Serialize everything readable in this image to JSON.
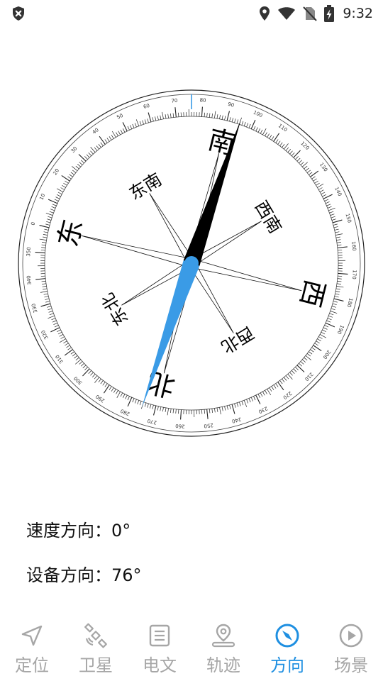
{
  "status_bar": {
    "time": "9:32",
    "left_icons": [
      "shield-x-icon"
    ],
    "right_icons": [
      "location-icon",
      "wifi-icon",
      "no-sim-icon",
      "battery-charging-icon"
    ]
  },
  "compass": {
    "cardinals": {
      "east": "东",
      "south": "南",
      "west": "西",
      "north": "北"
    },
    "intercardinals": {
      "northeast": "东北",
      "southeast": "东南",
      "southwest": "西南",
      "northwest": "西北"
    },
    "heading_degrees": 76,
    "needle_colors": {
      "north": "#3a9be6",
      "south": "#000000",
      "hub": "#3a9be6"
    }
  },
  "info": {
    "speed_direction": "速度方向：0°",
    "device_direction": "设备方向：76°"
  },
  "bottom_nav": {
    "active_color": "#1e8fe1",
    "inactive_color": "#a6a6a6",
    "items": [
      {
        "label": "定位",
        "icon": "navigation-arrow-icon",
        "active": false
      },
      {
        "label": "卫星",
        "icon": "satellite-icon",
        "active": false
      },
      {
        "label": "电文",
        "icon": "document-icon",
        "active": false
      },
      {
        "label": "轨迹",
        "icon": "location-pin-icon",
        "active": false
      },
      {
        "label": "方向",
        "icon": "compass-icon",
        "active": true
      },
      {
        "label": "场景",
        "icon": "play-circle-icon",
        "active": false
      }
    ]
  }
}
